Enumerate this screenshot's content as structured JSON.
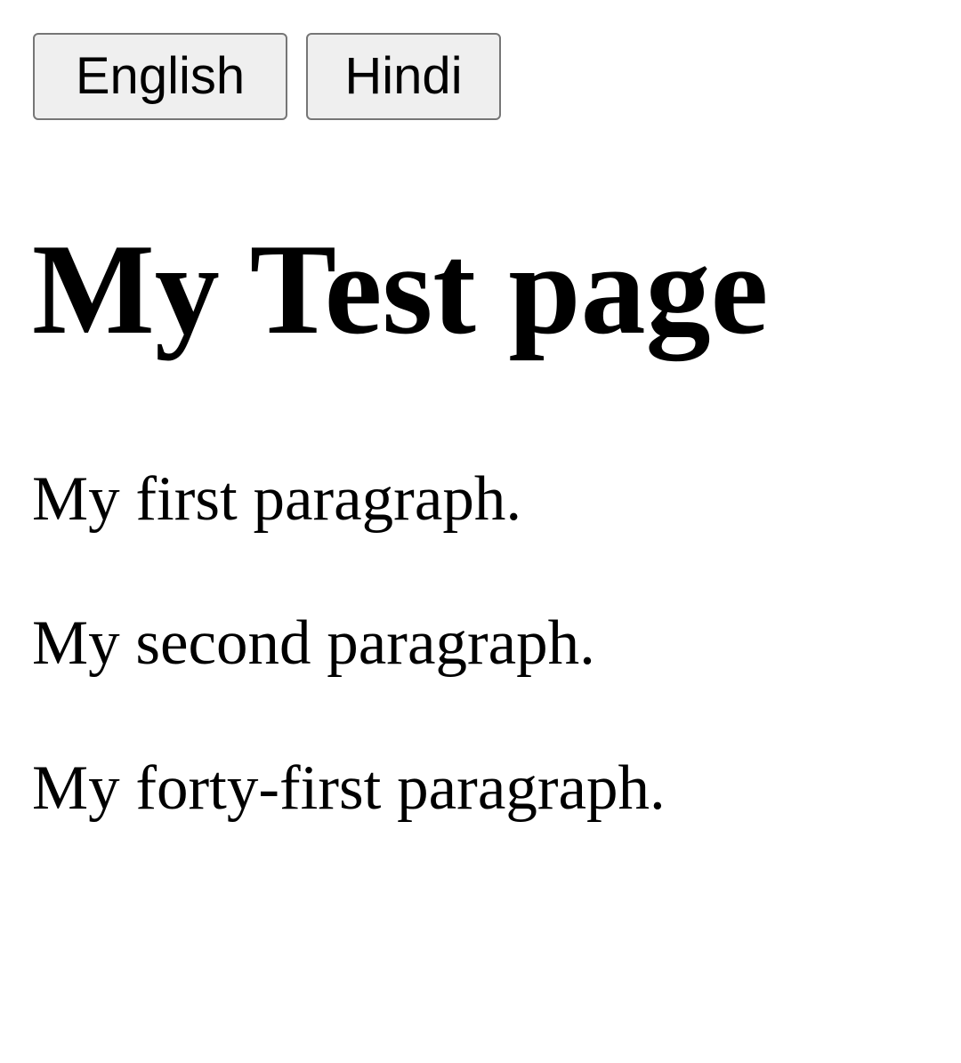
{
  "toolbar": {
    "english_label": "English",
    "hindi_label": "Hindi"
  },
  "main": {
    "title": "My Test page",
    "paragraphs": [
      "My first paragraph.",
      "My second paragraph.",
      "My forty-first paragraph."
    ]
  }
}
